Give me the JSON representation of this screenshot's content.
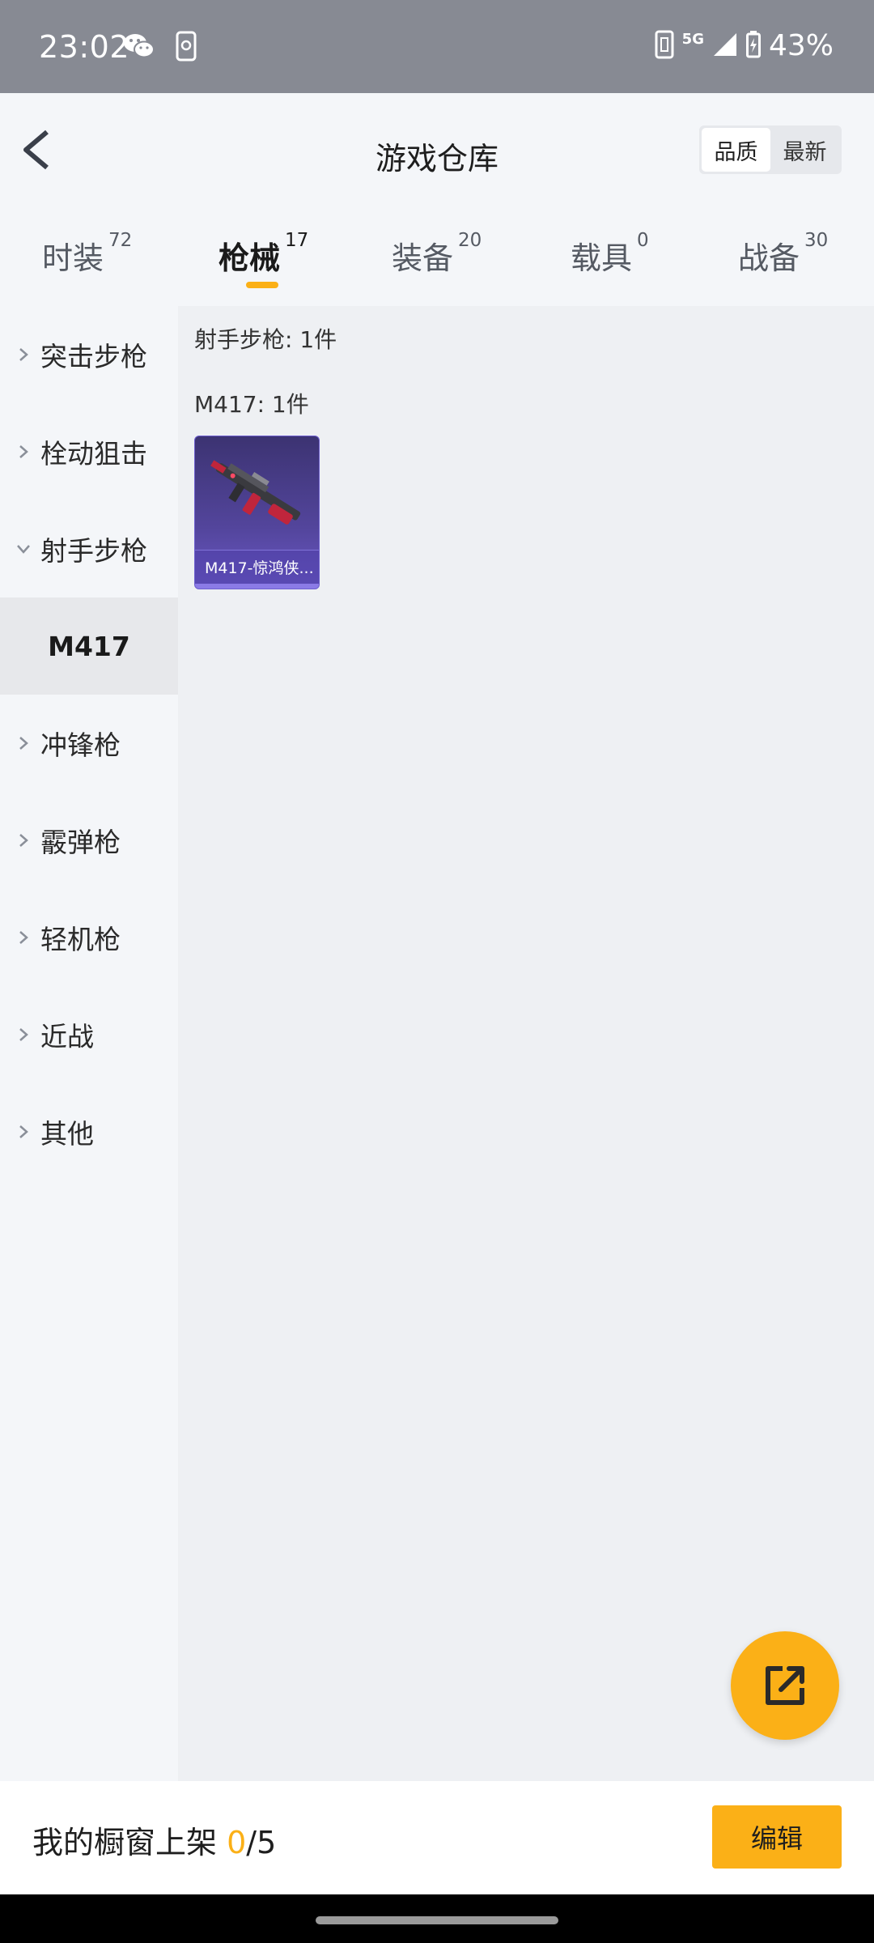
{
  "status_bar": {
    "time": "23:02",
    "network": "5G",
    "battery": "43%",
    "icons": [
      "wechat-icon",
      "phone-icon",
      "nfc-icon",
      "signal-icon",
      "battery-icon"
    ]
  },
  "header": {
    "title": "游戏仓库",
    "sort_options": [
      "品质",
      "最新"
    ]
  },
  "tabs": [
    {
      "label": "时装",
      "count": "72"
    },
    {
      "label": "枪械",
      "count": "17"
    },
    {
      "label": "装备",
      "count": "20"
    },
    {
      "label": "载具",
      "count": "0"
    },
    {
      "label": "战备",
      "count": "30"
    }
  ],
  "sidebar": {
    "items": [
      {
        "label": "突击步枪"
      },
      {
        "label": "栓动狙击"
      },
      {
        "label": "射手步枪"
      },
      {
        "label": "M417"
      },
      {
        "label": "冲锋枪"
      },
      {
        "label": "霰弹枪"
      },
      {
        "label": "轻机枪"
      },
      {
        "label": "近战"
      },
      {
        "label": "其他"
      }
    ]
  },
  "content": {
    "category_summary": "射手步枪: 1件",
    "subgroup_summary": "M417: 1件",
    "items": [
      {
        "name": "M417-惊鸿侠..."
      }
    ]
  },
  "bottom_bar": {
    "showcase_label": "我的橱窗上架 ",
    "showcase_count": "0",
    "showcase_total": "/5",
    "edit_label": "编辑"
  },
  "colors": {
    "accent": "#fbb017",
    "status_bar": "#878a93",
    "item_card": "#53459c"
  }
}
